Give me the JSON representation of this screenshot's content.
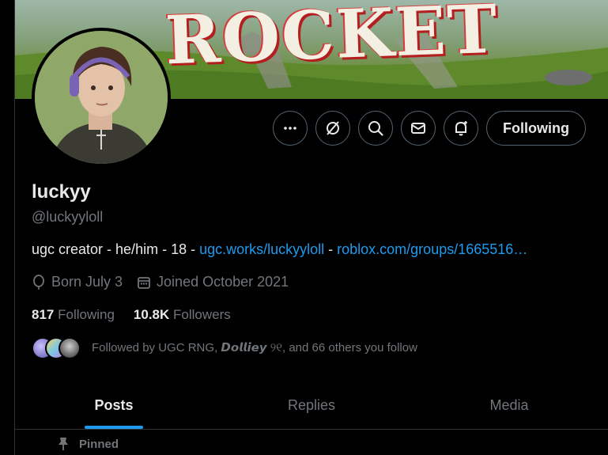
{
  "banner": {
    "text": "ROCKET"
  },
  "profile": {
    "name": "luckyy",
    "handle": "@luckyyloll",
    "bio": {
      "prefix": "ugc creator - he/him - 18 - ",
      "link1": "ugc.works/luckyyloll",
      "separator": " - ",
      "link2": "roblox.com/groups/1665516…"
    },
    "born": "Born July 3",
    "joined": "Joined October 2021"
  },
  "counts": {
    "following_num": "817",
    "following_label": "Following",
    "followers_num": "10.8K",
    "followers_label": "Followers"
  },
  "followed_by": {
    "prefix": "Followed by ",
    "user1": "UGC RNG",
    "sep": ", ",
    "user2": "𝘿𝙤𝙡𝙡𝙞𝙚𝙮 ୨୧",
    "suffix": ", and 66 others you follow"
  },
  "actions": {
    "more_icon": "more-icon",
    "grok_icon": "grok-icon",
    "search_icon": "search-icon",
    "message_icon": "mail-icon",
    "notify_icon": "bell-icon",
    "follow_label": "Following"
  },
  "tabs": [
    {
      "label": "Posts",
      "active": true
    },
    {
      "label": "Replies",
      "active": false
    },
    {
      "label": "Media",
      "active": false
    }
  ],
  "pinned": {
    "label": "Pinned"
  },
  "colors": {
    "accent": "#1d9bf0",
    "muted": "#71767b",
    "text": "#e7e9ea",
    "border": "#2f3336"
  }
}
